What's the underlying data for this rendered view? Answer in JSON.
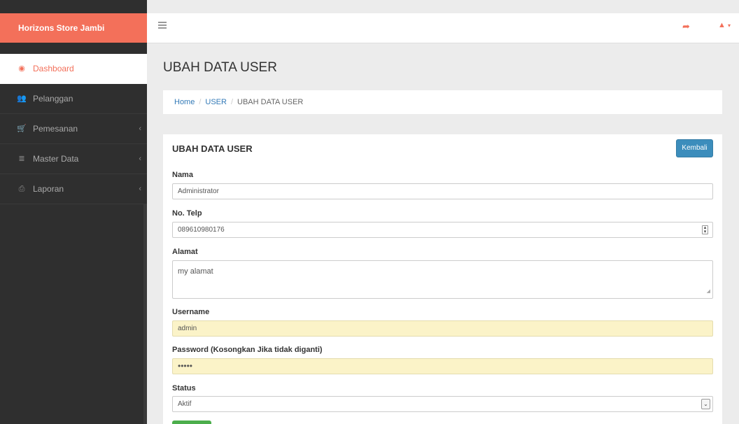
{
  "brand": "Horizons Store Jambi",
  "sidebar": {
    "items": [
      {
        "label": "Dashboard",
        "icon": "dashboard-icon",
        "glyph": "◉"
      },
      {
        "label": "Pelanggan",
        "icon": "users-icon",
        "glyph": "👥"
      },
      {
        "label": "Pemesanan",
        "icon": "cart-icon",
        "glyph": "🛒",
        "caret": "‹"
      },
      {
        "label": "Master Data",
        "icon": "database-icon",
        "glyph": "≣",
        "caret": "‹"
      },
      {
        "label": "Laporan",
        "icon": "print-icon",
        "glyph": "⎙",
        "caret": "‹"
      }
    ]
  },
  "topbar": {
    "share_glyph": "➦",
    "user_glyph": "▲",
    "caret_glyph": "▾"
  },
  "page_title": "UBAH DATA USER",
  "breadcrumb": {
    "home": "Home",
    "section": "USER",
    "current": "UBAH DATA USER",
    "separator": "/"
  },
  "panel": {
    "title": "UBAH DATA USER",
    "back_label": "Kembali",
    "fields": {
      "nama": {
        "label": "Nama",
        "value": "Administrator"
      },
      "telp": {
        "label": "No. Telp",
        "value": "089610980176"
      },
      "alamat": {
        "label": "Alamat",
        "value": "my alamat"
      },
      "username": {
        "label": "Username",
        "value": "admin"
      },
      "password": {
        "label": "Password (Kosongkan Jika tidak diganti)",
        "value": "•••••"
      },
      "status": {
        "label": "Status",
        "value": "Aktif"
      }
    }
  },
  "colors": {
    "accent": "#f3705a",
    "sidebar": "#2f2f2f",
    "primary": "#3c8dbc",
    "success": "#4cae4c",
    "autofill": "#fbf3c8"
  }
}
